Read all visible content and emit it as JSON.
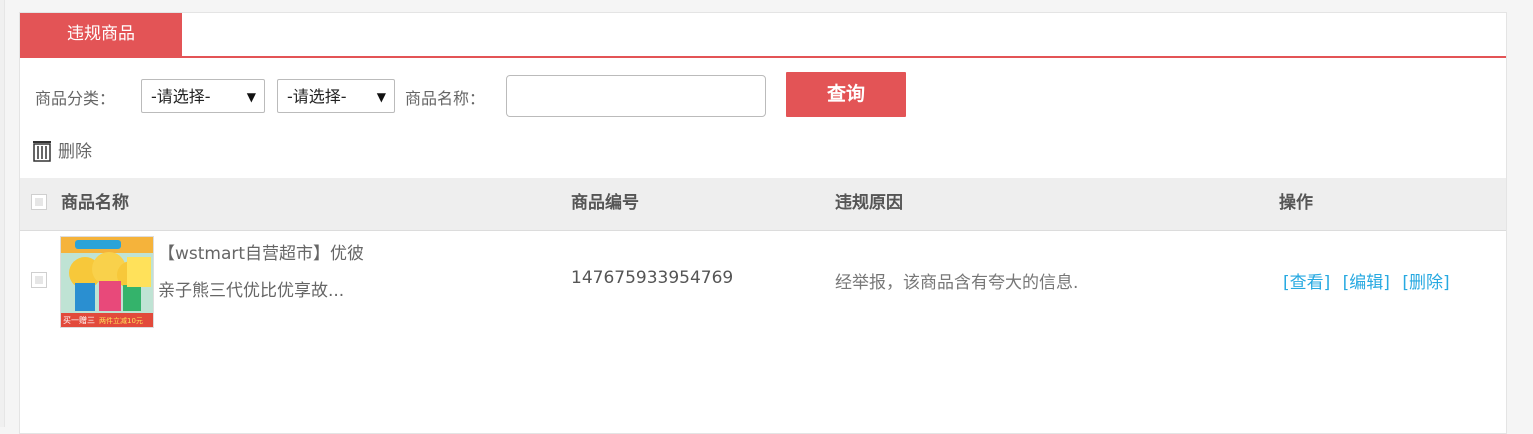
{
  "tab": {
    "label": "违规商品"
  },
  "filter": {
    "category_label": "商品分类：",
    "category1_value": "-请选择-",
    "category2_value": "-请选择-",
    "name_label": "商品名称：",
    "name_value": "",
    "search_label": "查询"
  },
  "actions": {
    "delete_label": "删除"
  },
  "table": {
    "headers": [
      "商品名称",
      "商品编号",
      "违规原因",
      "操作"
    ],
    "rows": [
      {
        "name_line1": "【wstmart自营超市】优彼",
        "name_line2": "亲子熊三代优比优享故...",
        "code": "147675933954769",
        "reason": "经举报，该商品含有夸大的信息.",
        "ops": [
          "[查看]",
          "[编辑]",
          "[删除]"
        ],
        "thumb": {
          "badge_text": "买一赠三",
          "promo_text": "两件立减10元"
        }
      }
    ]
  },
  "colors": {
    "accent": "#e35456",
    "link": "#27a9e1"
  }
}
